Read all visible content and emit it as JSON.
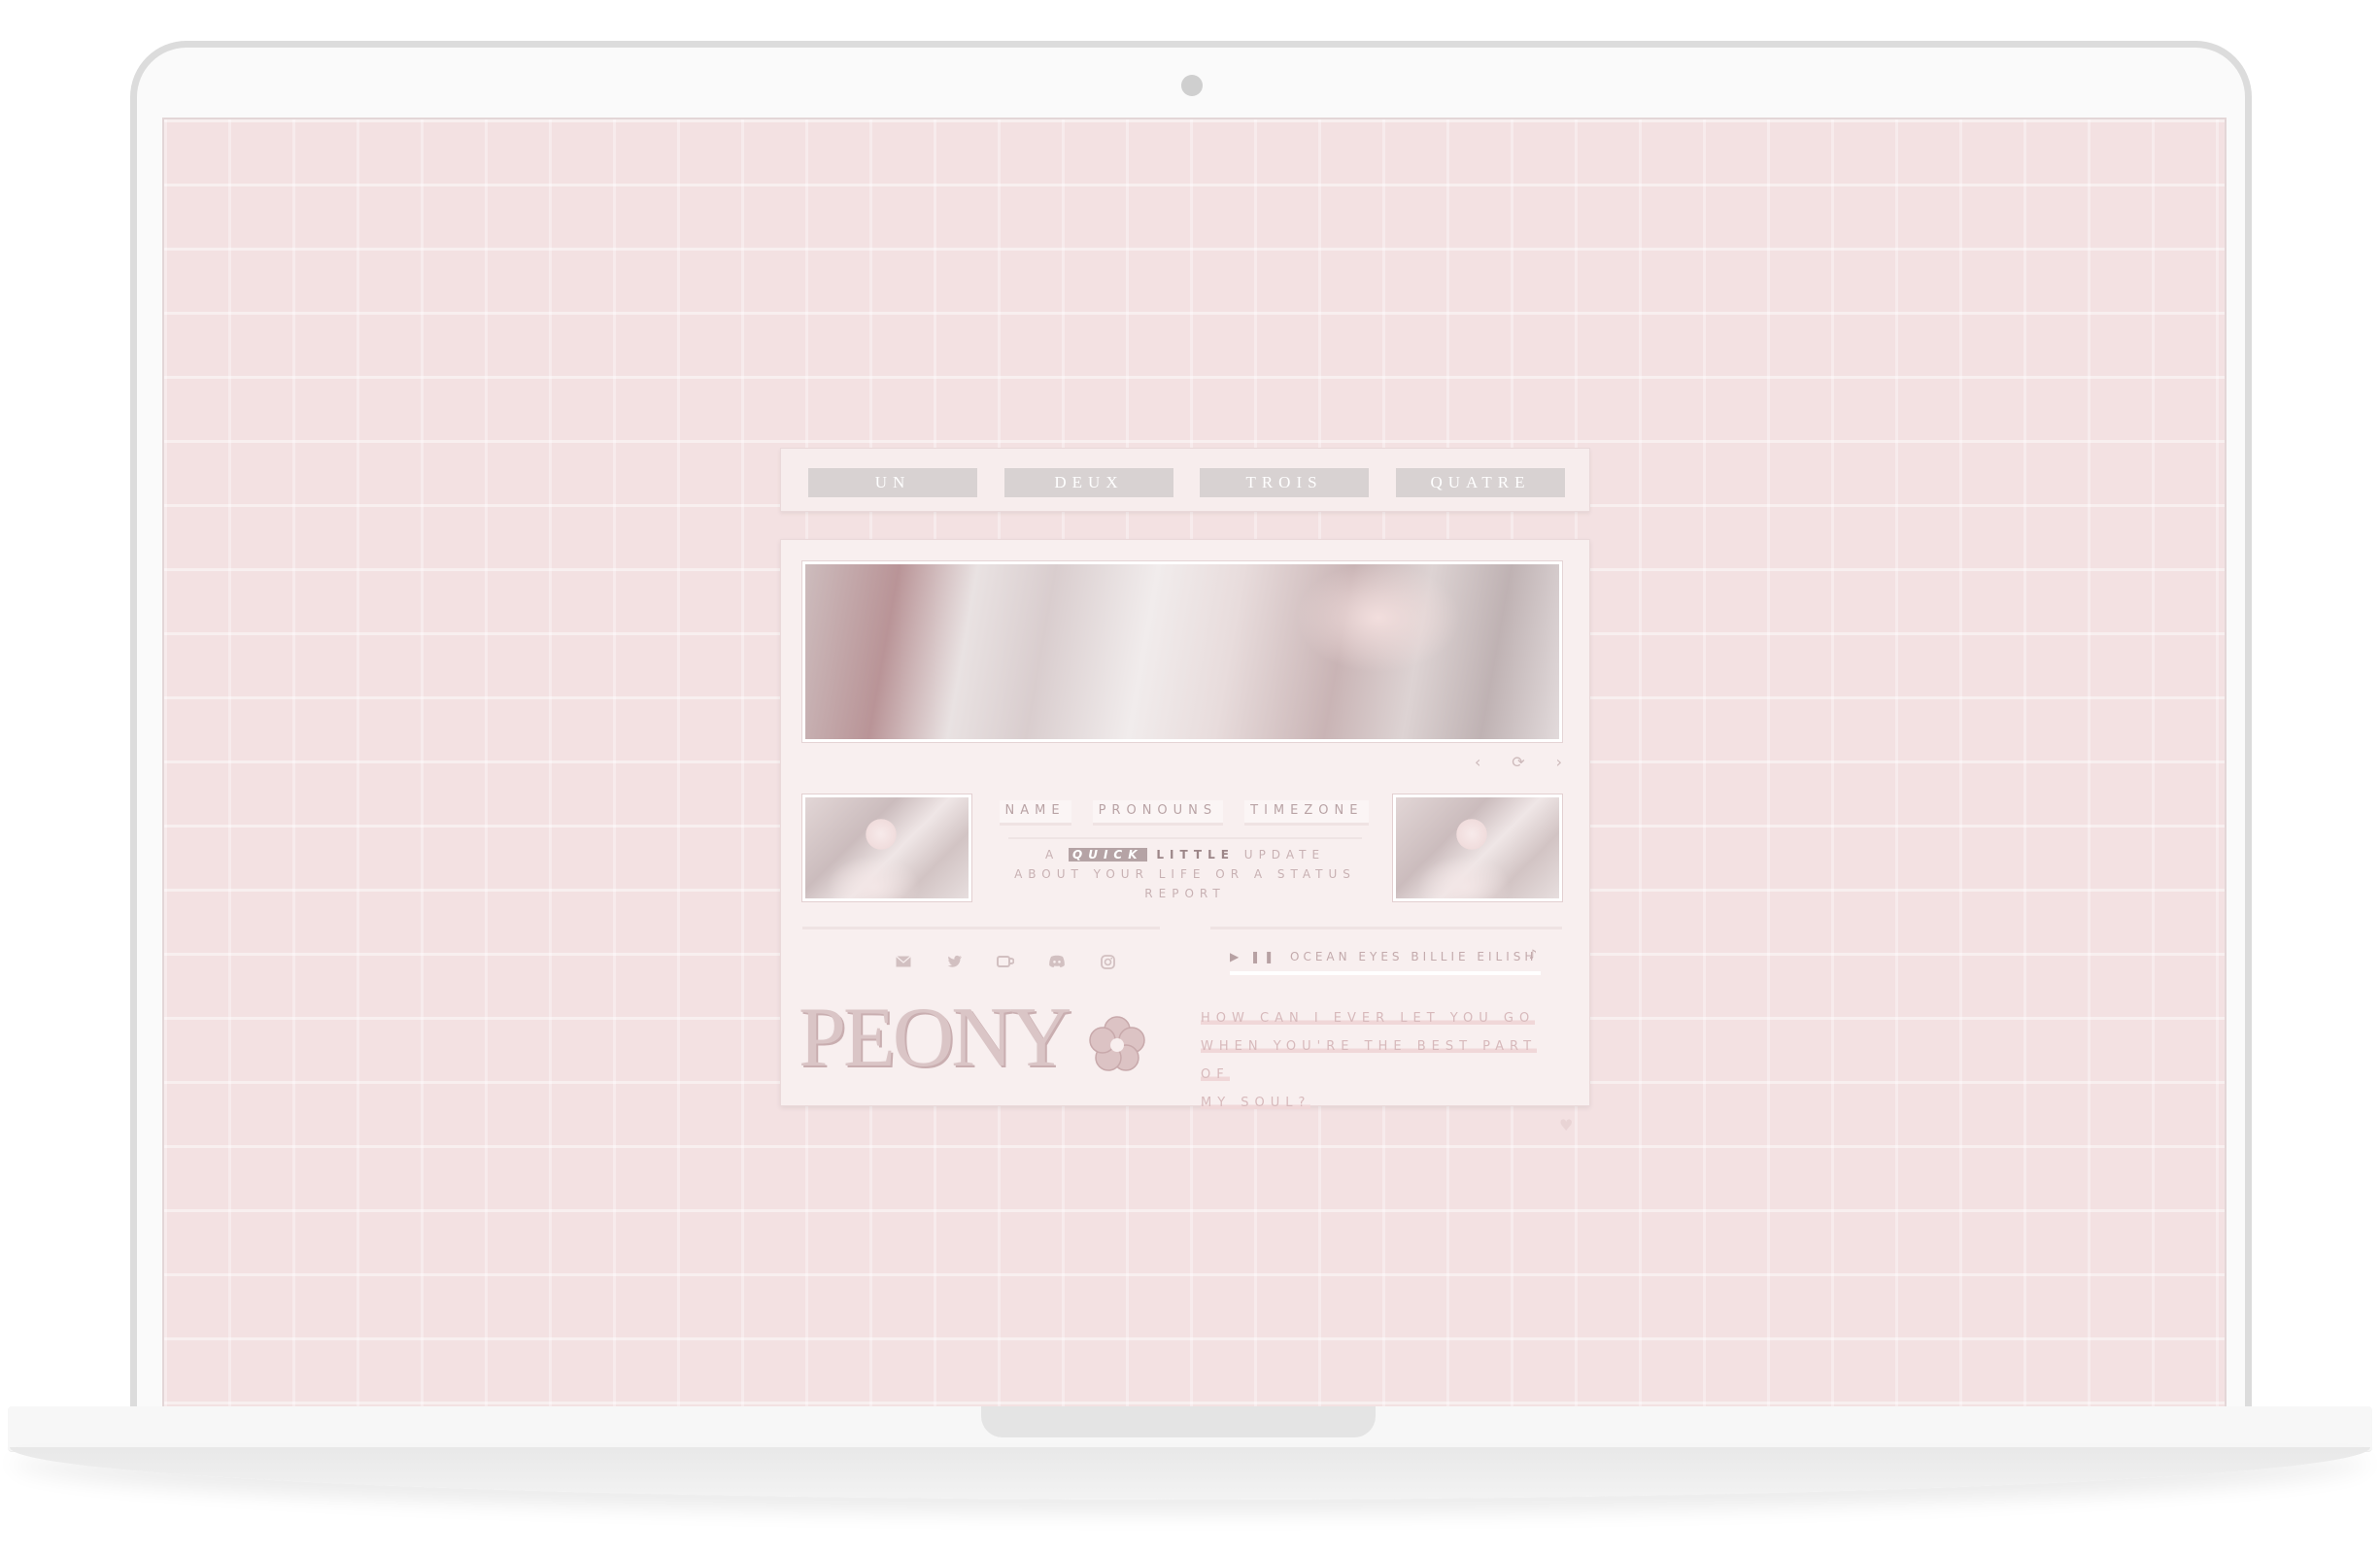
{
  "nav": {
    "items": [
      {
        "label": "UN"
      },
      {
        "label": "DEUX"
      },
      {
        "label": "TROIS"
      },
      {
        "label": "QUATRE"
      }
    ]
  },
  "banner": {
    "controls": [
      "‹",
      "⟳",
      "›"
    ]
  },
  "info": {
    "name": "NAME",
    "pronouns": "PRONOUNS",
    "timezone": "TIMEZONE"
  },
  "status": {
    "prefix": "A",
    "quick": "QUICK",
    "little": "LITTLE",
    "rest": "UPDATE ABOUT YOUR LIFE OR A STATUS REPORT"
  },
  "social": {
    "icons": [
      "mail-icon",
      "twitter-icon",
      "kofi-icon",
      "discord-icon",
      "instagram-icon"
    ]
  },
  "player": {
    "controls": "▶ ❚❚",
    "song": "OCEAN EYES   BILLIE EILISH",
    "note": "♪"
  },
  "logo": {
    "title": "PEONY"
  },
  "quote": {
    "line1": "HOW CAN I EVER LET YOU GO",
    "line2": "WHEN YOU'RE THE BEST PART OF",
    "line3": "MY SOUL?"
  },
  "colors": {
    "screen_bg": "#f3e1e2",
    "panel_bg": "#f8efef",
    "accent": "#d8d2d2",
    "text_muted": "#c8b1b3"
  }
}
